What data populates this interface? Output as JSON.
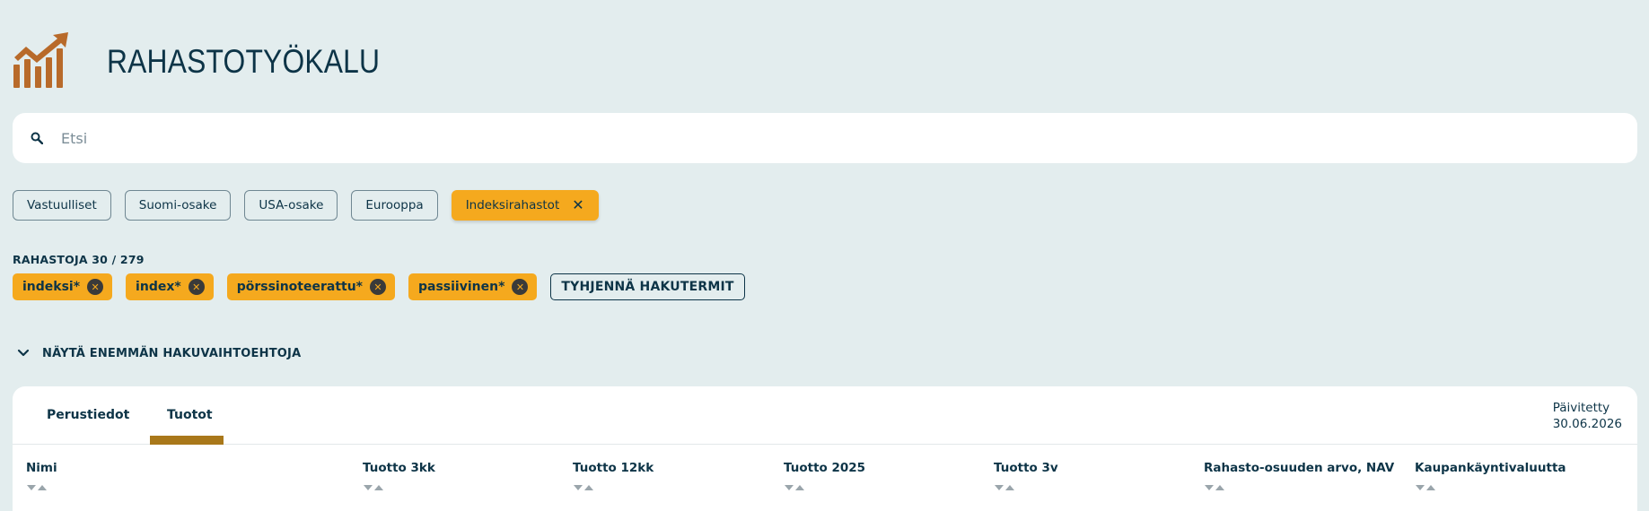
{
  "header": {
    "title": "RAHASTOTYÖKALU",
    "logo_icon": "growth-chart-icon",
    "logo_color": "#b86a2a"
  },
  "search": {
    "placeholder": "Etsi",
    "value": ""
  },
  "filters": [
    {
      "label": "Vastuulliset",
      "active": false
    },
    {
      "label": "Suomi-osake",
      "active": false
    },
    {
      "label": "USA-osake",
      "active": false
    },
    {
      "label": "Eurooppa",
      "active": false
    },
    {
      "label": "Indeksirahastot",
      "active": true
    }
  ],
  "results": {
    "count_label": "RAHASTOJA 30 / 279"
  },
  "search_terms": [
    {
      "label": "indeksi*"
    },
    {
      "label": "index*"
    },
    {
      "label": "pörssinoteerattu*"
    },
    {
      "label": "passiivinen*"
    }
  ],
  "clear_terms_label": "TYHJENNÄ HAKUTERMIT",
  "more_options_label": "NÄYTÄ ENEMMÄN HAKUVAIHTOEHTOJA",
  "table": {
    "tabs": [
      {
        "label": "Perustiedot",
        "active": false
      },
      {
        "label": "Tuotot",
        "active": true
      }
    ],
    "updated": {
      "label": "Päivitetty",
      "date": "30.06.2026"
    },
    "columns": [
      "Nimi",
      "Tuotto 3kk",
      "Tuotto 12kk",
      "Tuotto 2025",
      "Tuotto 3v",
      "Rahasto-osuuden arvo, NAV",
      "Kaupankäyntivaluutta"
    ]
  },
  "colors": {
    "accent": "#f5a91e",
    "text": "#0d3447",
    "background": "#e3edee",
    "tab_indicator": "#a9781a"
  }
}
